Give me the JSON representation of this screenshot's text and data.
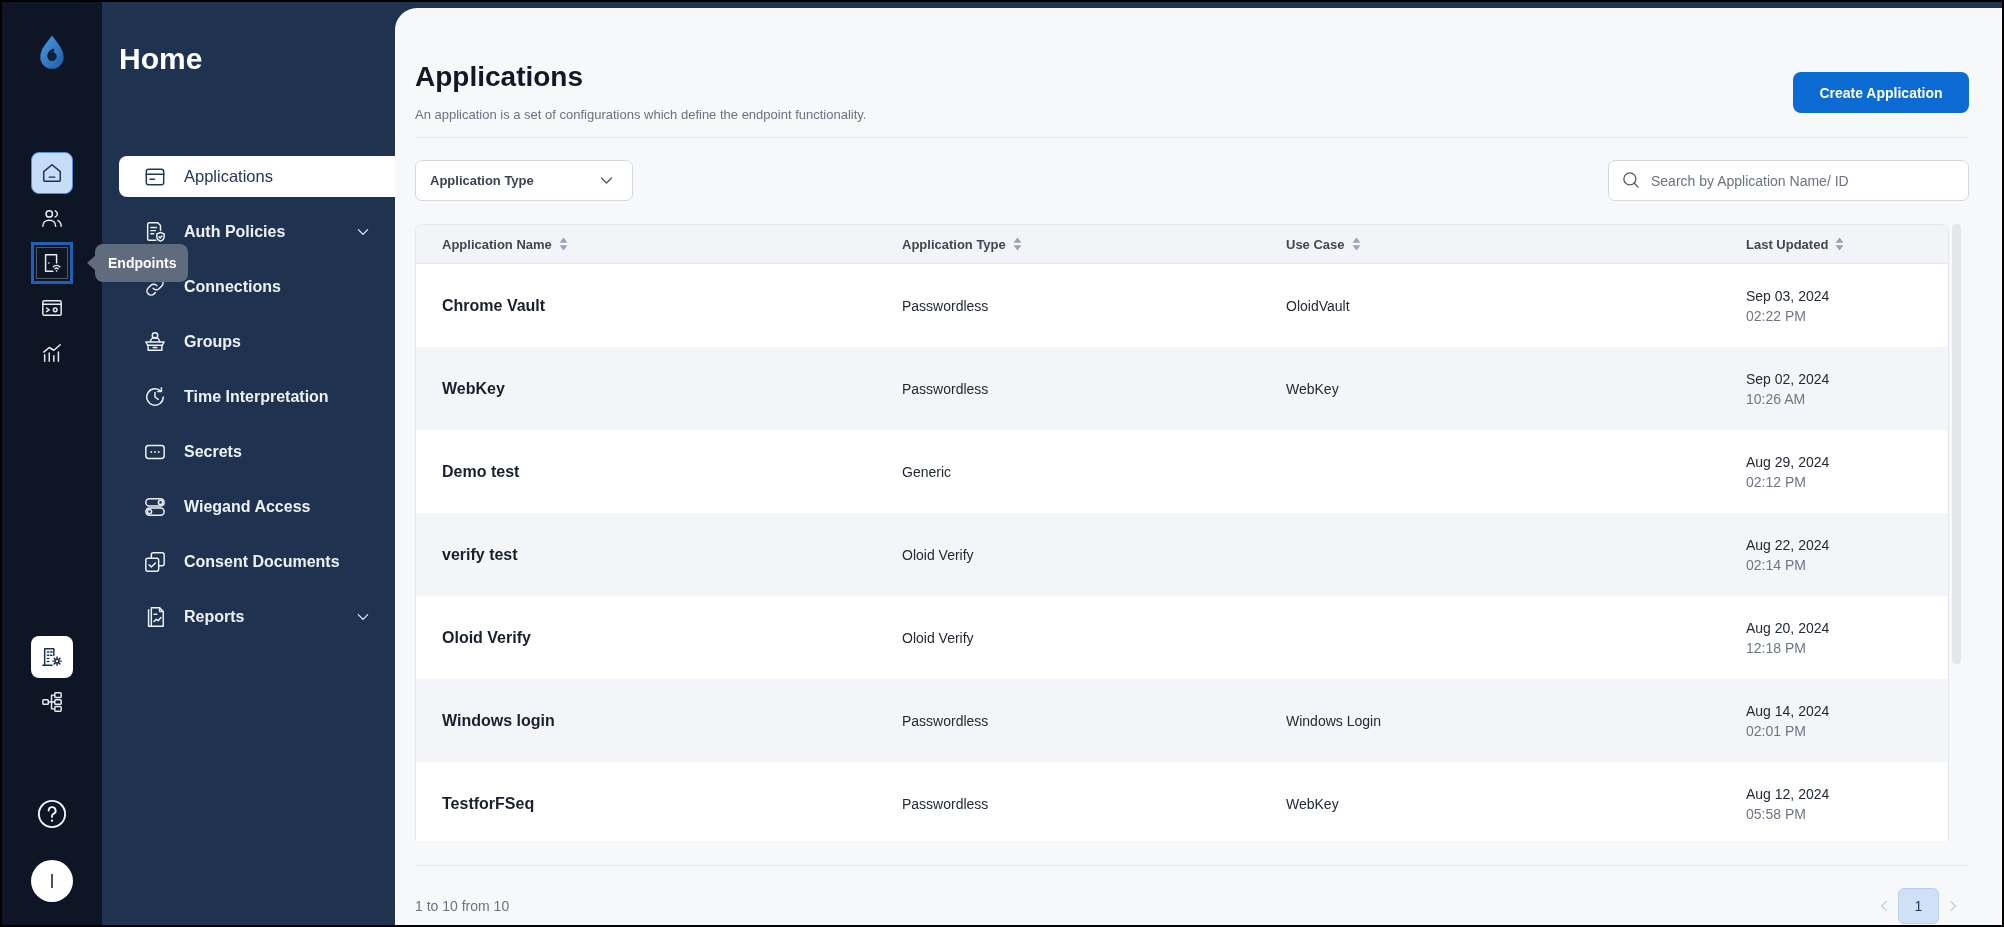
{
  "rail": {
    "top_items": [
      {
        "selected": true,
        "focused": false
      },
      {
        "selected": false,
        "focused": false
      },
      {
        "selected": false,
        "focused": true,
        "tooltip": "Endpoints"
      },
      {
        "selected": false,
        "focused": false
      },
      {
        "selected": false,
        "focused": false
      }
    ],
    "bottom_items": [
      {
        "selected": true
      },
      {
        "selected": false
      }
    ],
    "avatar": {
      "initial": "I"
    }
  },
  "sidebar": {
    "title": "Home",
    "items": [
      {
        "label": "Applications",
        "selected": true,
        "has_submenu": false
      },
      {
        "label": "Auth Policies",
        "selected": false,
        "has_submenu": true
      },
      {
        "label": "Connections",
        "selected": false,
        "has_submenu": false
      },
      {
        "label": "Groups",
        "selected": false,
        "has_submenu": false
      },
      {
        "label": "Time Interpretation",
        "selected": false,
        "has_submenu": false
      },
      {
        "label": "Secrets",
        "selected": false,
        "has_submenu": false
      },
      {
        "label": "Wiegand Access",
        "selected": false,
        "has_submenu": false
      },
      {
        "label": "Consent Documents",
        "selected": false,
        "has_submenu": false
      },
      {
        "label": "Reports",
        "selected": false,
        "has_submenu": true
      }
    ]
  },
  "page": {
    "title": "Applications",
    "subtitle": "An application is a set of configurations which define the endpoint functionality.",
    "primary_button": "Create Application",
    "filter": {
      "label": "Application Type"
    },
    "search": {
      "placeholder": "Search by Application Name/ ID"
    }
  },
  "table": {
    "columns": [
      {
        "label": "Application Name",
        "sortable": true
      },
      {
        "label": "Application Type",
        "sortable": true
      },
      {
        "label": "Use Case",
        "sortable": true
      },
      {
        "label": "Last Updated",
        "sortable": true
      }
    ],
    "rows": [
      {
        "name": "Chrome Vault",
        "type": "Passwordless",
        "use_case": "OloidVault",
        "date": "Sep 03, 2024",
        "time": "02:22 PM"
      },
      {
        "name": "WebKey",
        "type": "Passwordless",
        "use_case": "WebKey",
        "date": "Sep 02, 2024",
        "time": "10:26 AM"
      },
      {
        "name": "Demo test",
        "type": "Generic",
        "date": "Aug 29, 2024",
        "time": "02:12 PM"
      },
      {
        "name": "verify test",
        "type": "Oloid Verify",
        "date": "Aug 22, 2024",
        "time": "02:14 PM"
      },
      {
        "name": "Oloid Verify",
        "type": "Oloid Verify",
        "date": "Aug 20, 2024",
        "time": "12:18 PM"
      },
      {
        "name": "Windows login",
        "type": "Passwordless",
        "use_case": "Windows Login",
        "date": "Aug 14, 2024",
        "time": "02:01 PM"
      },
      {
        "name": "TestforFSeq",
        "type": "Passwordless",
        "use_case": "WebKey",
        "date": "Aug 12, 2024",
        "time": "05:58 PM"
      }
    ]
  },
  "footer": {
    "summary": "1 to 10 from 10",
    "prev": {
      "disabled": true
    },
    "pages": [
      {
        "label": "1",
        "selected": true
      }
    ],
    "next": {
      "disabled": true
    }
  }
}
